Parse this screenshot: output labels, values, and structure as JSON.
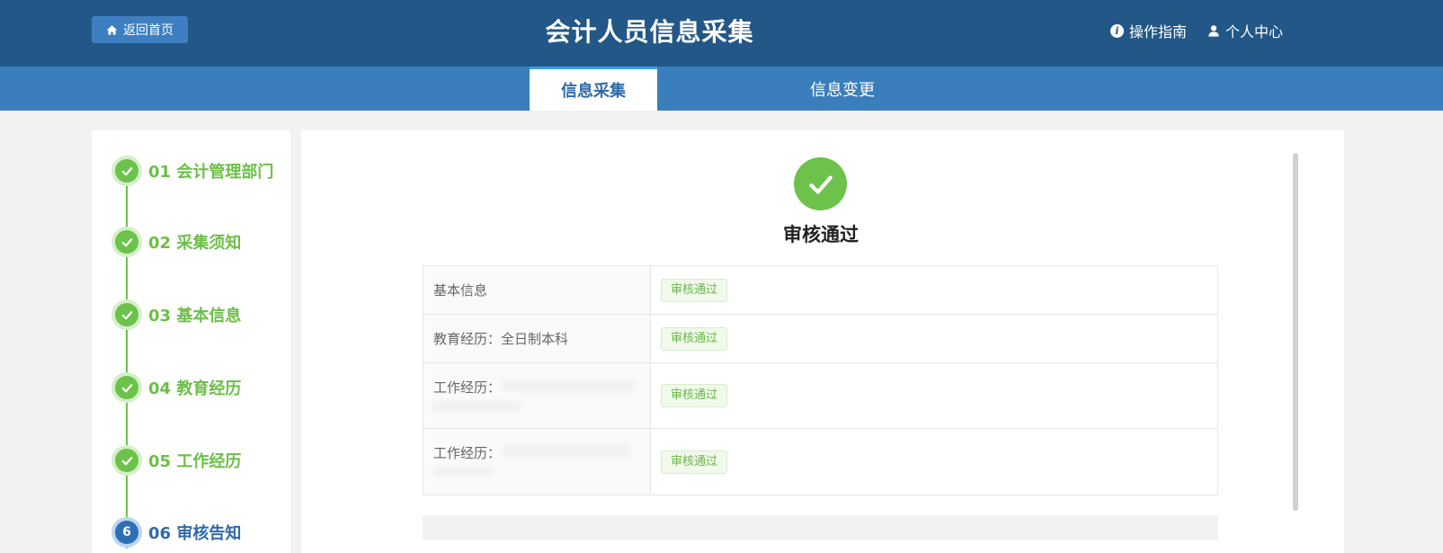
{
  "header": {
    "home_label": "返回首页",
    "title": "会计人员信息采集",
    "guide_label": "操作指南",
    "profile_label": "个人中心"
  },
  "tabs": [
    {
      "label": "信息采集",
      "active": true
    },
    {
      "label": "信息变更",
      "active": false
    }
  ],
  "steps": [
    {
      "label": "01 会计管理部门",
      "state": "done"
    },
    {
      "label": "02 采集须知",
      "state": "done"
    },
    {
      "label": "03 基本信息",
      "state": "done"
    },
    {
      "label": "04 教育经历",
      "state": "done"
    },
    {
      "label": "05 工作经历",
      "state": "done"
    },
    {
      "label": "06 审核告知",
      "state": "current",
      "number": "6"
    }
  ],
  "result": {
    "title": "审核通过",
    "rows": [
      {
        "label": "基本信息",
        "status": "审核通过"
      },
      {
        "label": "教育经历：全日制本科",
        "status": "审核通过"
      },
      {
        "label": "工作经历：",
        "status": "审核通过"
      },
      {
        "label": "工作经历：",
        "status": "审核通过"
      }
    ]
  },
  "colors": {
    "header_bg": "#225787",
    "tabs_bg": "#3a7ebb",
    "success": "#6cc24a",
    "primary": "#2e6fb3"
  },
  "icons": {
    "home": "home-icon",
    "guide": "info-icon",
    "profile": "user-icon",
    "check": "check-icon"
  }
}
